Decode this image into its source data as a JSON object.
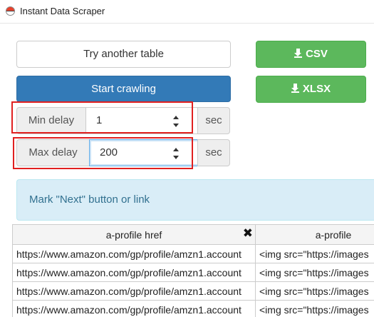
{
  "window": {
    "title": "Instant Data Scraper",
    "icon": "pokeball-icon"
  },
  "buttons": {
    "try_another": "Try another table",
    "start_crawling": "Start crawling",
    "csv": "CSV",
    "xlsx": "XLSX"
  },
  "delays": {
    "min": {
      "label": "Min delay",
      "value": "1",
      "unit": "sec"
    },
    "max": {
      "label": "Max delay",
      "value": "200",
      "unit": "sec"
    }
  },
  "info": {
    "text": "Mark \"Next\" button or link"
  },
  "table": {
    "headers": [
      "a-profile href",
      "a-profile"
    ],
    "rows": [
      [
        "https://www.amazon.com/gp/profile/amzn1.account",
        "<img src=\"https://images"
      ],
      [
        "https://www.amazon.com/gp/profile/amzn1.account",
        "<img src=\"https://images"
      ],
      [
        "https://www.amazon.com/gp/profile/amzn1.account",
        "<img src=\"https://images"
      ],
      [
        "https://www.amazon.com/gp/profile/amzn1.account",
        "<img src=\"https://images"
      ]
    ]
  },
  "colors": {
    "primary": "#337ab7",
    "success": "#5cb85c",
    "info_bg": "#d9edf7",
    "info_text": "#31708f",
    "highlight": "#e02020"
  }
}
